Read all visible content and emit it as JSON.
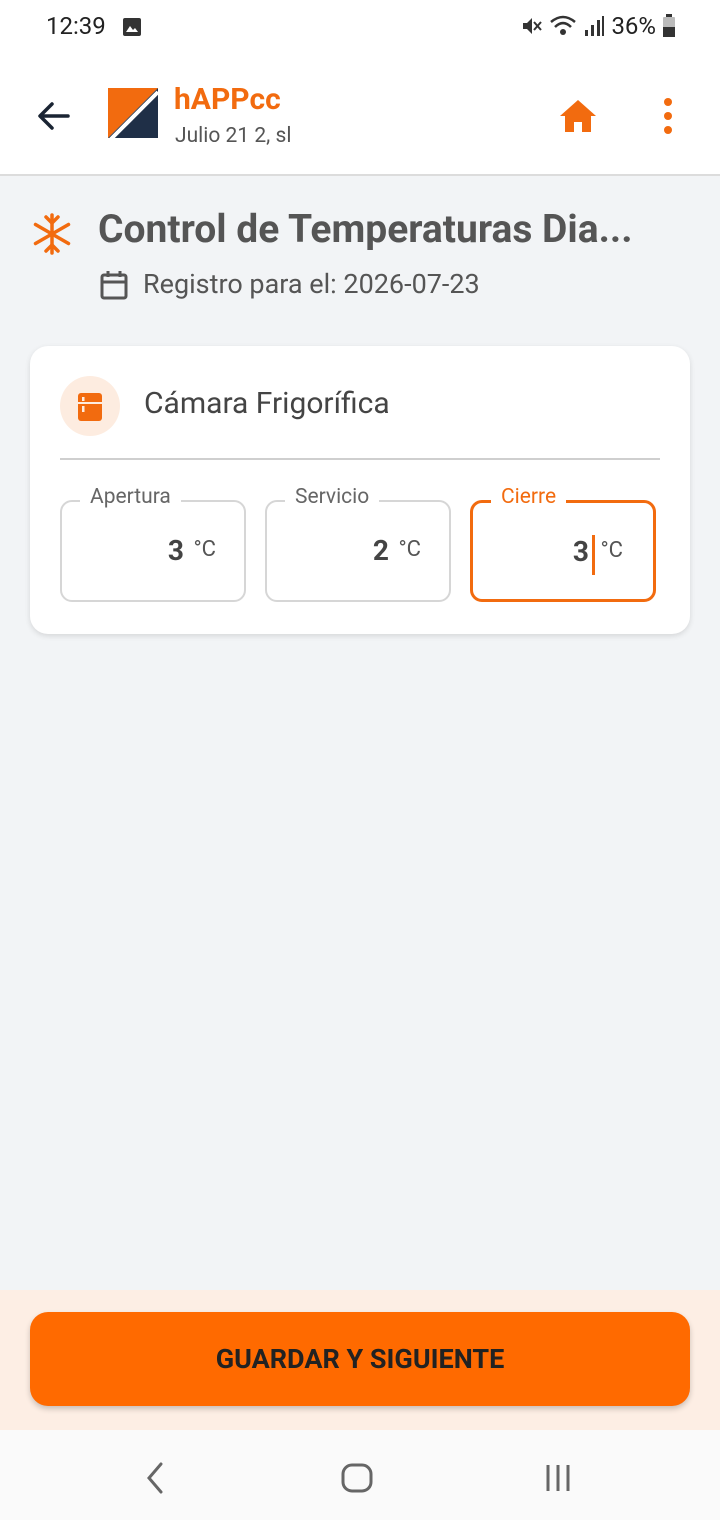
{
  "status_bar": {
    "time": "12:39",
    "battery": "36%"
  },
  "app_bar": {
    "app_name": "hAPPcc",
    "company": "Julio 21 2, sl"
  },
  "page": {
    "title": "Control de Temperaturas Dia...",
    "record_label": "Registro para el: 2026-07-23"
  },
  "card": {
    "title": "Cámara Frigorífica",
    "fields": [
      {
        "label": "Apertura",
        "value": "3",
        "unit": "°C"
      },
      {
        "label": "Servicio",
        "value": "2",
        "unit": "°C"
      },
      {
        "label": "Cierre",
        "value": "3",
        "unit": "°C"
      }
    ]
  },
  "footer": {
    "save_label": "GUARDAR Y SIGUIENTE"
  },
  "colors": {
    "accent": "#f26b0f",
    "button": "#ff6a00",
    "background": "#f2f4f6"
  }
}
